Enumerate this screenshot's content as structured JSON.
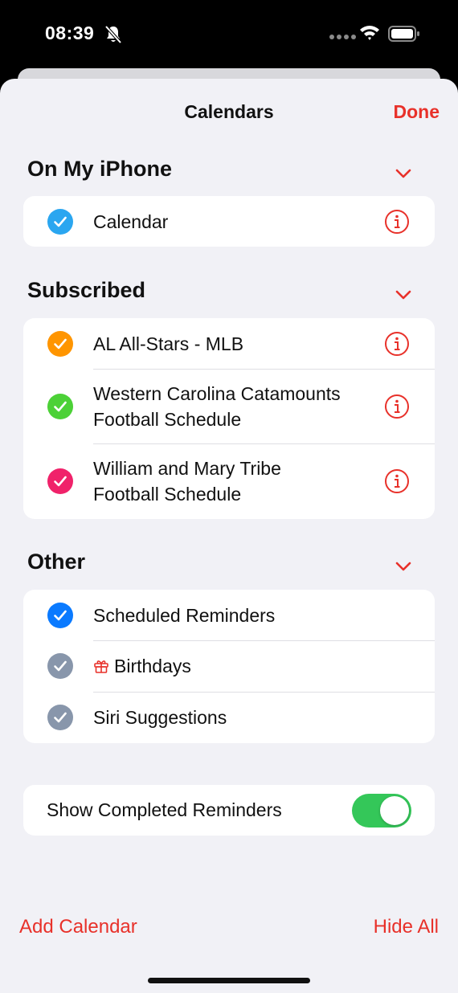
{
  "status_bar": {
    "time": "08:39"
  },
  "sheet": {
    "title": "Calendars",
    "done_label": "Done"
  },
  "sections": [
    {
      "title": "On My iPhone",
      "rows": [
        {
          "lines": [
            "Calendar"
          ],
          "color": "#2aa6f0",
          "has_info": true
        }
      ]
    },
    {
      "title": "Subscribed",
      "rows": [
        {
          "lines": [
            "AL All-Stars - MLB"
          ],
          "color": "#ff9500",
          "has_info": true
        },
        {
          "lines": [
            "Western Carolina Catamounts",
            "Football Schedule"
          ],
          "color": "#4cd137",
          "has_info": true
        },
        {
          "lines": [
            "William and Mary Tribe",
            "Football Schedule"
          ],
          "color": "#f0226a",
          "has_info": true
        }
      ]
    },
    {
      "title": "Other",
      "rows": [
        {
          "lines": [
            "Scheduled Reminders"
          ],
          "color": "#0a7aff",
          "has_info": false
        },
        {
          "lines": [
            "Birthdays"
          ],
          "color": "#8896ab",
          "has_info": false,
          "icon": "gift-icon"
        },
        {
          "lines": [
            "Siri Suggestions"
          ],
          "color": "#8896ab",
          "has_info": false
        }
      ]
    }
  ],
  "show_completed": {
    "label": "Show Completed Reminders",
    "on": true
  },
  "footer": {
    "add_calendar": "Add Calendar",
    "hide_all": "Hide All"
  },
  "colors": {
    "accent": "#e8312a",
    "toggle_on": "#34c759"
  }
}
